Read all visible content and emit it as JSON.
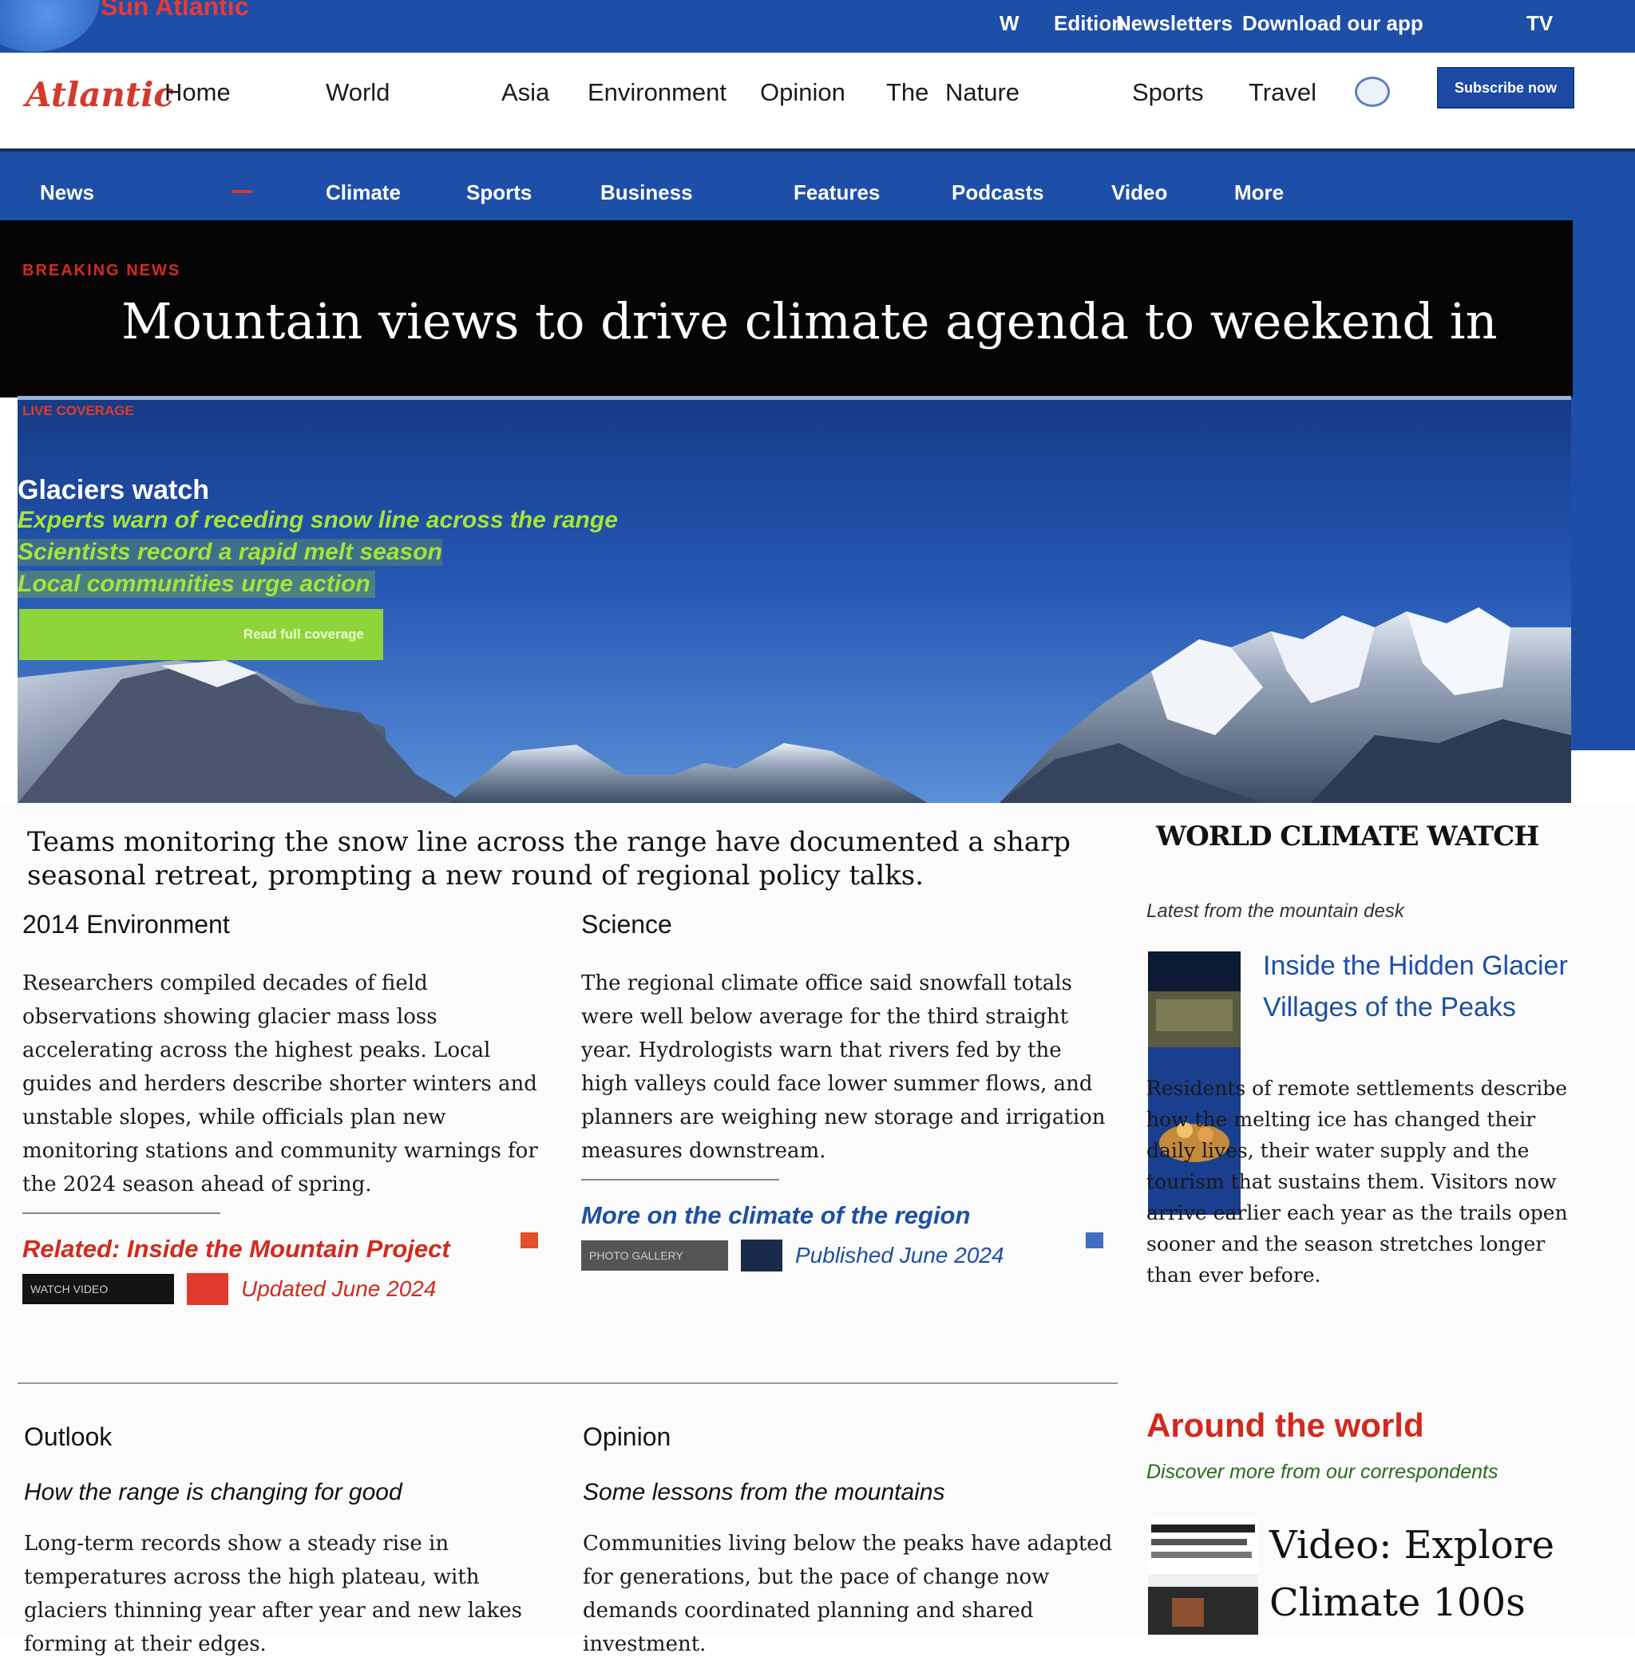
{
  "brand": {
    "name": "Sun Atlantic"
  },
  "utility_nav": [
    {
      "label": "W"
    },
    {
      "label": "Edition"
    },
    {
      "label": "Newsletters"
    },
    {
      "label": "Download our app"
    },
    {
      "label": "TV"
    }
  ],
  "header": {
    "logo": "Atlantic",
    "nav": [
      "Home",
      "World",
      "Asia",
      "Environment",
      "Opinion",
      "The",
      "Nature",
      "Sports",
      "Travel"
    ],
    "subscribe_label": "Subscribe now"
  },
  "section_nav": [
    "News",
    "Climate",
    "Sports",
    "Business",
    "Features",
    "Podcasts",
    "Video",
    "More"
  ],
  "hero": {
    "kicker": "BREAKING NEWS",
    "headline": "Mountain views to drive climate agenda to weekend in",
    "image_kicker": "LIVE COVERAGE",
    "label": "Glaciers watch",
    "lines": [
      "Experts warn of receding snow line across the range",
      "Scientists record a rapid melt season",
      "Local communities urge action"
    ],
    "cta": "Read full coverage"
  },
  "summary": "Teams monitoring the snow line across the range have documented a sharp seasonal retreat, prompting a new round of regional policy talks.",
  "stories": [
    {
      "kicker": "2014 Environment",
      "body": "Researchers compiled decades of field observations showing glacier mass loss accelerating across the highest peaks. Local guides and herders describe shorter winters and unstable slopes, while officials plan new monitoring stations and community warnings for the 2024 season ahead of spring.",
      "related": "Related: Inside the Mountain Project",
      "meta": "WATCH VIDEO",
      "date": "Updated June 2024"
    },
    {
      "kicker": "Science",
      "body": "The regional climate office said snowfall totals were well below average for the third straight year. Hydrologists warn that rivers fed by the high valleys could face lower summer flows, and planners are weighing new storage and irrigation measures downstream.",
      "related": "More on the climate of the region",
      "meta": "PHOTO GALLERY",
      "date": "Published June 2024"
    }
  ],
  "lower_stories": [
    {
      "kicker": "Outlook",
      "deck": "How the range is changing for good",
      "body": "Long-term records show a steady rise in temperatures across the high plateau, with glaciers thinning year after year and new lakes forming at their edges."
    },
    {
      "kicker": "Opinion",
      "deck": "Some lessons from the mountains",
      "body": "Communities living below the peaks have adapted for generations, but the pace of change now demands coordinated planning and shared investment."
    }
  ],
  "sidebar": {
    "title": "WORLD CLIMATE WATCH",
    "subtitle": "Latest from the mountain desk",
    "headline": "Inside the Hidden Glacier Villages of the Peaks",
    "body": "Residents of remote settlements describe how the melting ice has changed their daily lives, their water supply and the tourism that sustains them. Visitors now arrive earlier each year as the trails open sooner and the season stretches longer than ever before.",
    "promo": "Around the world",
    "promo_sub": "Discover more from our correspondents",
    "video": "Video: Explore Climate 100s"
  },
  "colors": {
    "brand_blue": "#1e4fa8",
    "accent_red": "#d33a2c",
    "accent_green": "#8fd43a",
    "hero_black": "#050505"
  }
}
